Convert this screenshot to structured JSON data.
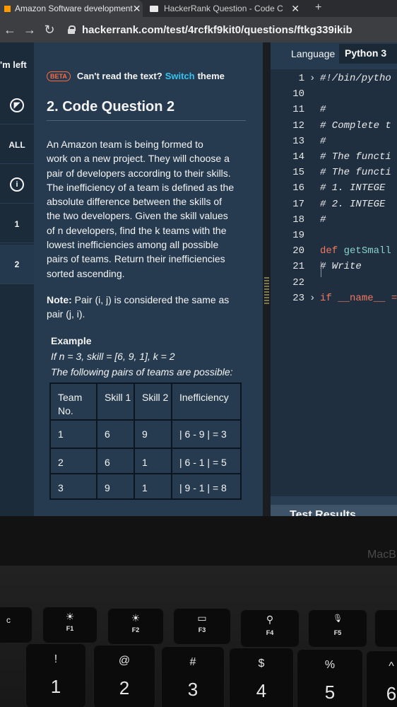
{
  "browser": {
    "tabs": [
      {
        "title": "Amazon Software development",
        "close": "✕"
      },
      {
        "title": "HackerRank Question - Code C",
        "close": "✕"
      }
    ],
    "new_tab": "+",
    "url": "hackerrank.com/test/4rcfkf9kit0/questions/ftkg339ikib"
  },
  "sidebar": {
    "time_left": "'m left",
    "items": [
      {
        "label": "",
        "icon": "compass-icon"
      },
      {
        "label": "ALL"
      },
      {
        "label": "i",
        "icon": "info-icon"
      },
      {
        "label": "1"
      },
      {
        "label": "2"
      }
    ]
  },
  "problem": {
    "beta": "BETA",
    "theme_prefix": "Can't read the text?",
    "theme_link": "Switch",
    "theme_suffix": "theme",
    "title": "2. Code Question 2",
    "description": [
      "An Amazon team is being formed to",
      "work on a new project.  They will choose a",
      "pair of developers according to their skills.",
      "The inefficiency of a team is defined as the",
      "absolute difference between the skills of",
      "the two developers. Given the skill values",
      "of n developers, find the k teams with the",
      "lowest inefficiencies among all possible",
      "pairs of teams.  Return their inefficiencies",
      "sorted ascending."
    ],
    "note_label": "Note:",
    "note_text": " Pair (i, j) is considered the same as",
    "note_text2": "pair (j, i).",
    "example_heading": "Example",
    "example_line1": "If n = 3, skill = [6, 9, 1], k = 2",
    "example_line2": "The following pairs of teams are possible:",
    "table": {
      "headers": [
        "Team No.",
        "Skill 1",
        "Skill 2",
        "Inefficiency"
      ],
      "rows": [
        [
          "1",
          "6",
          "9",
          "| 6 - 9 | = 3"
        ],
        [
          "2",
          "6",
          "1",
          "| 6 - 1 | = 5"
        ],
        [
          "3",
          "9",
          "1",
          "| 9 - 1 | = 8"
        ]
      ]
    }
  },
  "editor": {
    "language_label": "Language",
    "language": "Python 3",
    "lines": [
      {
        "n": "1",
        "fold": "›",
        "text": "#!/bin/pytho",
        "kind": "comment"
      },
      {
        "n": "10",
        "fold": "",
        "text": "",
        "kind": "plain"
      },
      {
        "n": "11",
        "fold": "",
        "text": "#",
        "kind": "comment"
      },
      {
        "n": "12",
        "fold": "",
        "text": "# Complete t",
        "kind": "comment"
      },
      {
        "n": "13",
        "fold": "",
        "text": "#",
        "kind": "comment"
      },
      {
        "n": "14",
        "fold": "",
        "text": "# The functi",
        "kind": "comment"
      },
      {
        "n": "15",
        "fold": "",
        "text": "# The functi",
        "kind": "comment"
      },
      {
        "n": "16",
        "fold": "",
        "text": "#  1. INTEGE",
        "kind": "comment"
      },
      {
        "n": "17",
        "fold": "",
        "text": "#  2. INTEGE",
        "kind": "comment"
      },
      {
        "n": "18",
        "fold": "",
        "text": "#",
        "kind": "comment"
      },
      {
        "n": "19",
        "fold": "",
        "text": "",
        "kind": "plain"
      },
      {
        "n": "20",
        "fold": "",
        "kw": "def",
        "text": "getSmall",
        "kind": "def"
      },
      {
        "n": "21",
        "fold": "",
        "text": "    # Write ",
        "kind": "comment"
      },
      {
        "n": "22",
        "fold": "",
        "text": "",
        "kind": "plain"
      },
      {
        "n": "23",
        "fold": "›",
        "kw": "if",
        "text": "__name__ =",
        "kind": "if"
      }
    ],
    "test_results": "Test Results"
  },
  "laptop": {
    "brand": "MacB",
    "fn_keys": [
      {
        "icon": "☀",
        "label": "F1"
      },
      {
        "icon": "☀",
        "label": "F2"
      },
      {
        "icon": "▭",
        "label": "F3"
      },
      {
        "icon": "⚲",
        "label": "F4"
      },
      {
        "icon": "🎙",
        "label": "F5"
      }
    ],
    "number_keys": [
      {
        "top": "!",
        "main": "1"
      },
      {
        "top": "@",
        "main": "2"
      },
      {
        "top": "#",
        "main": "3"
      },
      {
        "top": "$",
        "main": "4"
      },
      {
        "top": "%",
        "main": "5"
      },
      {
        "top": "^",
        "main": "6"
      }
    ],
    "left_key": "c"
  }
}
